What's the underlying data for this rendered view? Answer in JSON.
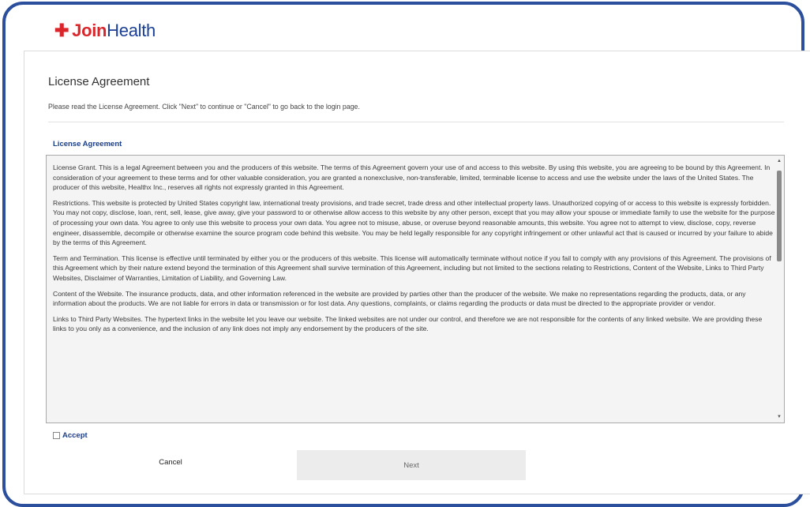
{
  "brand": {
    "cross": "✚",
    "join": "Join",
    "health": "Health"
  },
  "page": {
    "title": "License Agreement",
    "instructions": "Please read the License Agreement. Click \"Next\" to continue or \"Cancel\" to go back to the login page.",
    "section_title": "License Agreement"
  },
  "agreement": {
    "paragraphs": [
      "License Grant. This is a legal Agreement between you and the producers of this website. The terms of this Agreement govern your use of and access to this website. By using this website, you are agreeing to be bound by this Agreement. In consideration of your agreement to these terms and for other valuable consideration, you are granted a nonexclusive, non-transferable, limited, terminable license to access and use the website under the laws of the United States. The producer of this website, Healthx Inc., reserves all rights not expressly granted in this Agreement.",
      "Restrictions. This website is protected by United States copyright law, international treaty provisions, and trade secret, trade dress and other intellectual property laws. Unauthorized copying of or access to this website is expressly forbidden. You may not copy, disclose, loan, rent, sell, lease, give away, give your password to or otherwise allow access to this website by any other person, except that you may allow your spouse or immediate family to use the website for the purpose of processing your own data. You agree to only use this website to process your own data. You agree not to misuse, abuse, or overuse beyond reasonable amounts, this website. You agree not to attempt to view, disclose, copy, reverse engineer, disassemble, decompile or otherwise examine the source program code behind this website. You may be held legally responsible for any copyright infringement or other unlawful act that is caused or incurred by your failure to abide by the terms of this Agreement.",
      "Term and Termination. This license is effective until terminated by either you or the producers of this website. This license will automatically terminate without notice if you fail to comply with any provisions of this Agreement. The provisions of this Agreement which by their nature extend beyond the termination of this Agreement shall survive termination of this Agreement, including but not limited to the sections relating to Restrictions, Content of the Website, Links to Third Party Websites, Disclaimer of Warranties, Limitation of Liability, and Governing Law.",
      "Content of the Website. The insurance products, data, and other information referenced in the website are provided by parties other than the producer of the website. We make no representations regarding the products, data, or any information about the products. We are not liable for errors in data or transmission or for lost data. Any questions, complaints, or claims regarding the products or data must be directed to the appropriate provider or vendor.",
      "Links to Third Party Websites. The hypertext links in the website let you leave our website. The linked websites are not under our control, and therefore we are not responsible for the contents of any linked website. We are providing these links to you only as a convenience, and the inclusion of any link does not imply any endorsement by the producers of the site."
    ]
  },
  "accept": {
    "label": "Accept",
    "checked": false
  },
  "buttons": {
    "cancel": "Cancel",
    "next": "Next"
  },
  "icons": {
    "scroll_up": "▲",
    "scroll_down": "▼"
  },
  "colors": {
    "frame": "#2b4f9c",
    "brand_red": "#d9262b",
    "brand_blue": "#1b3f95",
    "link_blue": "#1b3f8a"
  }
}
